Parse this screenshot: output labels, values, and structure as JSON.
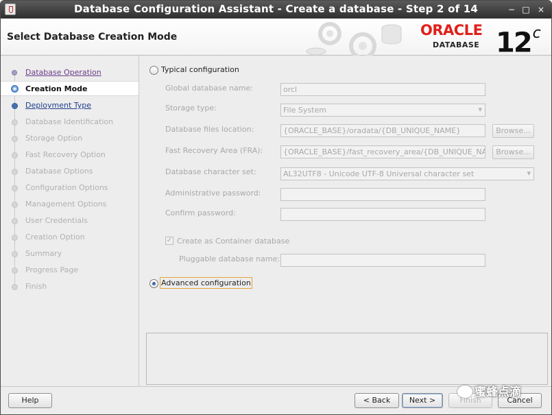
{
  "window": {
    "title": "Database Configuration Assistant - Create a database - Step 2 of 14",
    "minimize_glyph": "−",
    "maximize_glyph": "□",
    "close_glyph": "×"
  },
  "header": {
    "page_title": "Select Database Creation Mode",
    "brand": "ORACLE",
    "brand_sub": "DATABASE",
    "version": "12",
    "version_suffix": "c",
    "brand_color": "#e0201a"
  },
  "nav": {
    "items": [
      {
        "label": "Database Operation",
        "state": "done"
      },
      {
        "label": "Creation Mode",
        "state": "current"
      },
      {
        "label": "Deployment Type",
        "state": "link"
      },
      {
        "label": "Database Identification",
        "state": "disabled"
      },
      {
        "label": "Storage Option",
        "state": "disabled"
      },
      {
        "label": "Fast Recovery Option",
        "state": "disabled"
      },
      {
        "label": "Database Options",
        "state": "disabled"
      },
      {
        "label": "Configuration Options",
        "state": "disabled"
      },
      {
        "label": "Management Options",
        "state": "disabled"
      },
      {
        "label": "User Credentials",
        "state": "disabled"
      },
      {
        "label": "Creation Option",
        "state": "disabled"
      },
      {
        "label": "Summary",
        "state": "disabled"
      },
      {
        "label": "Progress Page",
        "state": "disabled"
      },
      {
        "label": "Finish",
        "state": "disabled"
      }
    ]
  },
  "mode": {
    "typical_label": "Typical configuration",
    "advanced_label": "Advanced configuration",
    "selected": "advanced"
  },
  "typical": {
    "global_db_name_label": "Global database name:",
    "global_db_name_value": "orcl",
    "storage_type_label": "Storage type:",
    "storage_type_value": "File System",
    "db_files_location_label": "Database files location:",
    "db_files_location_value": "{ORACLE_BASE}/oradata/{DB_UNIQUE_NAME}",
    "fra_label": "Fast Recovery Area (FRA):",
    "fra_value": "{ORACLE_BASE}/fast_recovery_area/{DB_UNIQUE_NAME}",
    "charset_label": "Database character set:",
    "charset_value": "AL32UTF8 - Unicode UTF-8 Universal character set",
    "admin_password_label": "Administrative password:",
    "admin_password_value": "",
    "confirm_password_label": "Confirm password:",
    "confirm_password_value": "",
    "container_label": "Create as Container database",
    "container_checked": true,
    "pluggable_label": "Pluggable database name:",
    "pluggable_value": "",
    "browse_label": "Browse..."
  },
  "footer": {
    "help": "Help",
    "back": "< Back",
    "next": "Next >",
    "finish": "Finish",
    "cancel": "Cancel"
  },
  "watermark": {
    "text": "蜜蜂点滴"
  }
}
